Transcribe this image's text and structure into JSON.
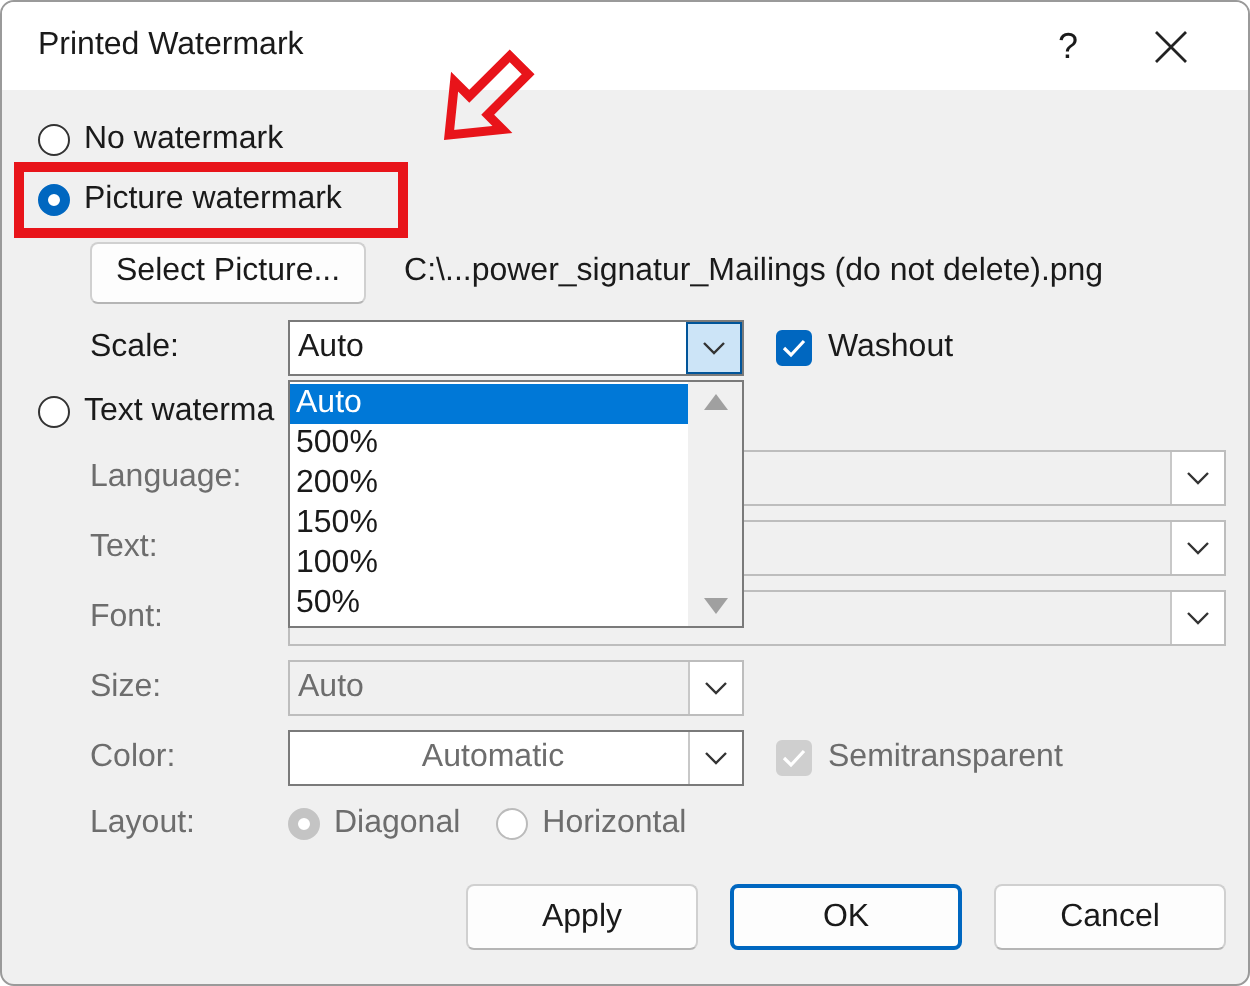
{
  "window": {
    "title": "Printed Watermark",
    "help": "?"
  },
  "no_watermark": {
    "label": "No watermark",
    "selected": false
  },
  "picture_watermark": {
    "label": "Picture watermark",
    "selected": true,
    "highlighted": true
  },
  "select_picture": {
    "label": "Select Picture...",
    "path": "C:\\...power_signatur_Mailings (do not delete).png"
  },
  "scale": {
    "label": "Scale:",
    "value": "Auto",
    "expanded": true,
    "options": [
      {
        "label": "Auto",
        "selected": true
      },
      {
        "label": "500%",
        "selected": false
      },
      {
        "label": "200%",
        "selected": false
      },
      {
        "label": "150%",
        "selected": false
      },
      {
        "label": "100%",
        "selected": false
      },
      {
        "label": "50%",
        "selected": false
      }
    ]
  },
  "washout": {
    "label": "Washout",
    "checked": true
  },
  "text_watermark": {
    "label": "Text waterma",
    "selected": false
  },
  "text_fields": [
    {
      "label": "Language:",
      "kind": "wide",
      "disabled": true
    },
    {
      "label": "Text:",
      "kind": "wide",
      "disabled": true
    },
    {
      "label": "Font:",
      "kind": "wide",
      "disabled": true
    },
    {
      "label": "Size:",
      "kind": "combo",
      "value": "Auto",
      "disabled": true
    },
    {
      "label": "Color:",
      "kind": "color",
      "value": "Automatic",
      "disabled": true
    }
  ],
  "semitransparent": {
    "label": "Semitransparent",
    "checked": true,
    "disabled": true
  },
  "layout": {
    "label": "Layout:",
    "options": [
      {
        "label": "Diagonal",
        "selected": true,
        "disabled": true
      },
      {
        "label": "Horizontal",
        "selected": false,
        "disabled": true
      }
    ]
  },
  "buttons": [
    {
      "label": "Apply",
      "default": false
    },
    {
      "label": "OK",
      "default": true
    },
    {
      "label": "Cancel",
      "default": false
    }
  ]
}
